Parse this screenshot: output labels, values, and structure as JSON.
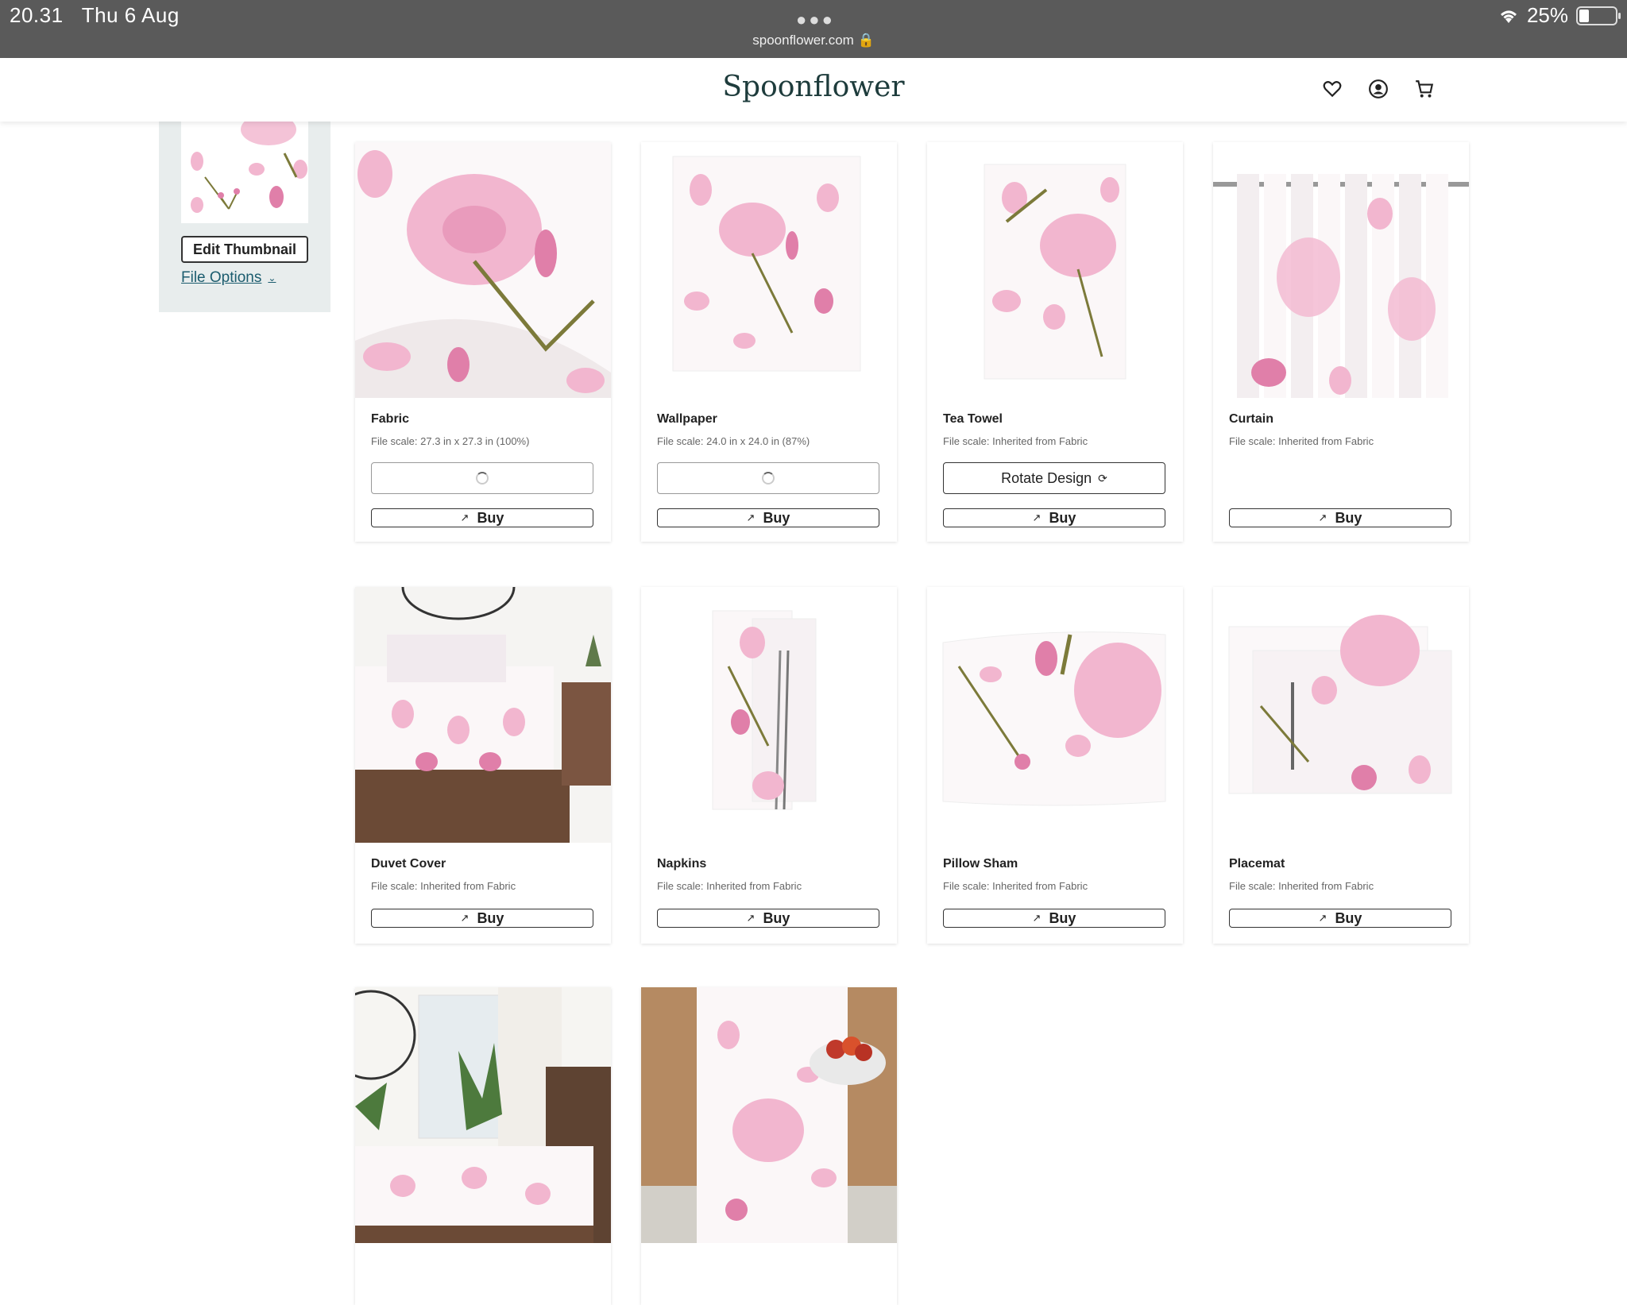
{
  "status": {
    "time": "20.31",
    "date": "Thu 6 Aug",
    "url": "spoonflower.com",
    "battery": "25%",
    "battery_level": 0.25
  },
  "header": {
    "logo": "Spoonflower"
  },
  "sidebar": {
    "edit_thumbnail": "Edit Thumbnail",
    "file_options": "File Options"
  },
  "products": [
    {
      "title": "Fabric",
      "scale": "File scale: 27.3 in x 27.3 in (100%)",
      "secondary": "",
      "secondary_state": "loading",
      "buy": "Buy"
    },
    {
      "title": "Wallpaper",
      "scale": "File scale: 24.0 in x 24.0 in (87%)",
      "secondary": "",
      "secondary_state": "loading",
      "buy": "Buy"
    },
    {
      "title": "Tea Towel",
      "scale": "File scale: Inherited from Fabric",
      "secondary": "Rotate Design",
      "secondary_state": "button",
      "buy": "Buy"
    },
    {
      "title": "Curtain",
      "scale": "File scale: Inherited from Fabric",
      "secondary": "",
      "secondary_state": "none",
      "buy": "Buy"
    },
    {
      "title": "Duvet Cover",
      "scale": "File scale: Inherited from Fabric",
      "secondary": "",
      "secondary_state": "none",
      "buy": "Buy"
    },
    {
      "title": "Napkins",
      "scale": "File scale: Inherited from Fabric",
      "secondary": "",
      "secondary_state": "none",
      "buy": "Buy"
    },
    {
      "title": "Pillow Sham",
      "scale": "File scale: Inherited from Fabric",
      "secondary": "",
      "secondary_state": "none",
      "buy": "Buy"
    },
    {
      "title": "Placemat",
      "scale": "File scale: Inherited from Fabric",
      "secondary": "",
      "secondary_state": "none",
      "buy": "Buy"
    },
    {
      "title": "",
      "scale": "",
      "secondary": "",
      "secondary_state": "none",
      "buy": ""
    },
    {
      "title": "",
      "scale": "",
      "secondary": "",
      "secondary_state": "none",
      "buy": ""
    }
  ],
  "colors": {
    "petal": "#f2b6cf",
    "petal_dark": "#e07fa9",
    "stem": "#7c7a3a",
    "logo": "#1e3c3c",
    "link": "#1b5c6e"
  }
}
